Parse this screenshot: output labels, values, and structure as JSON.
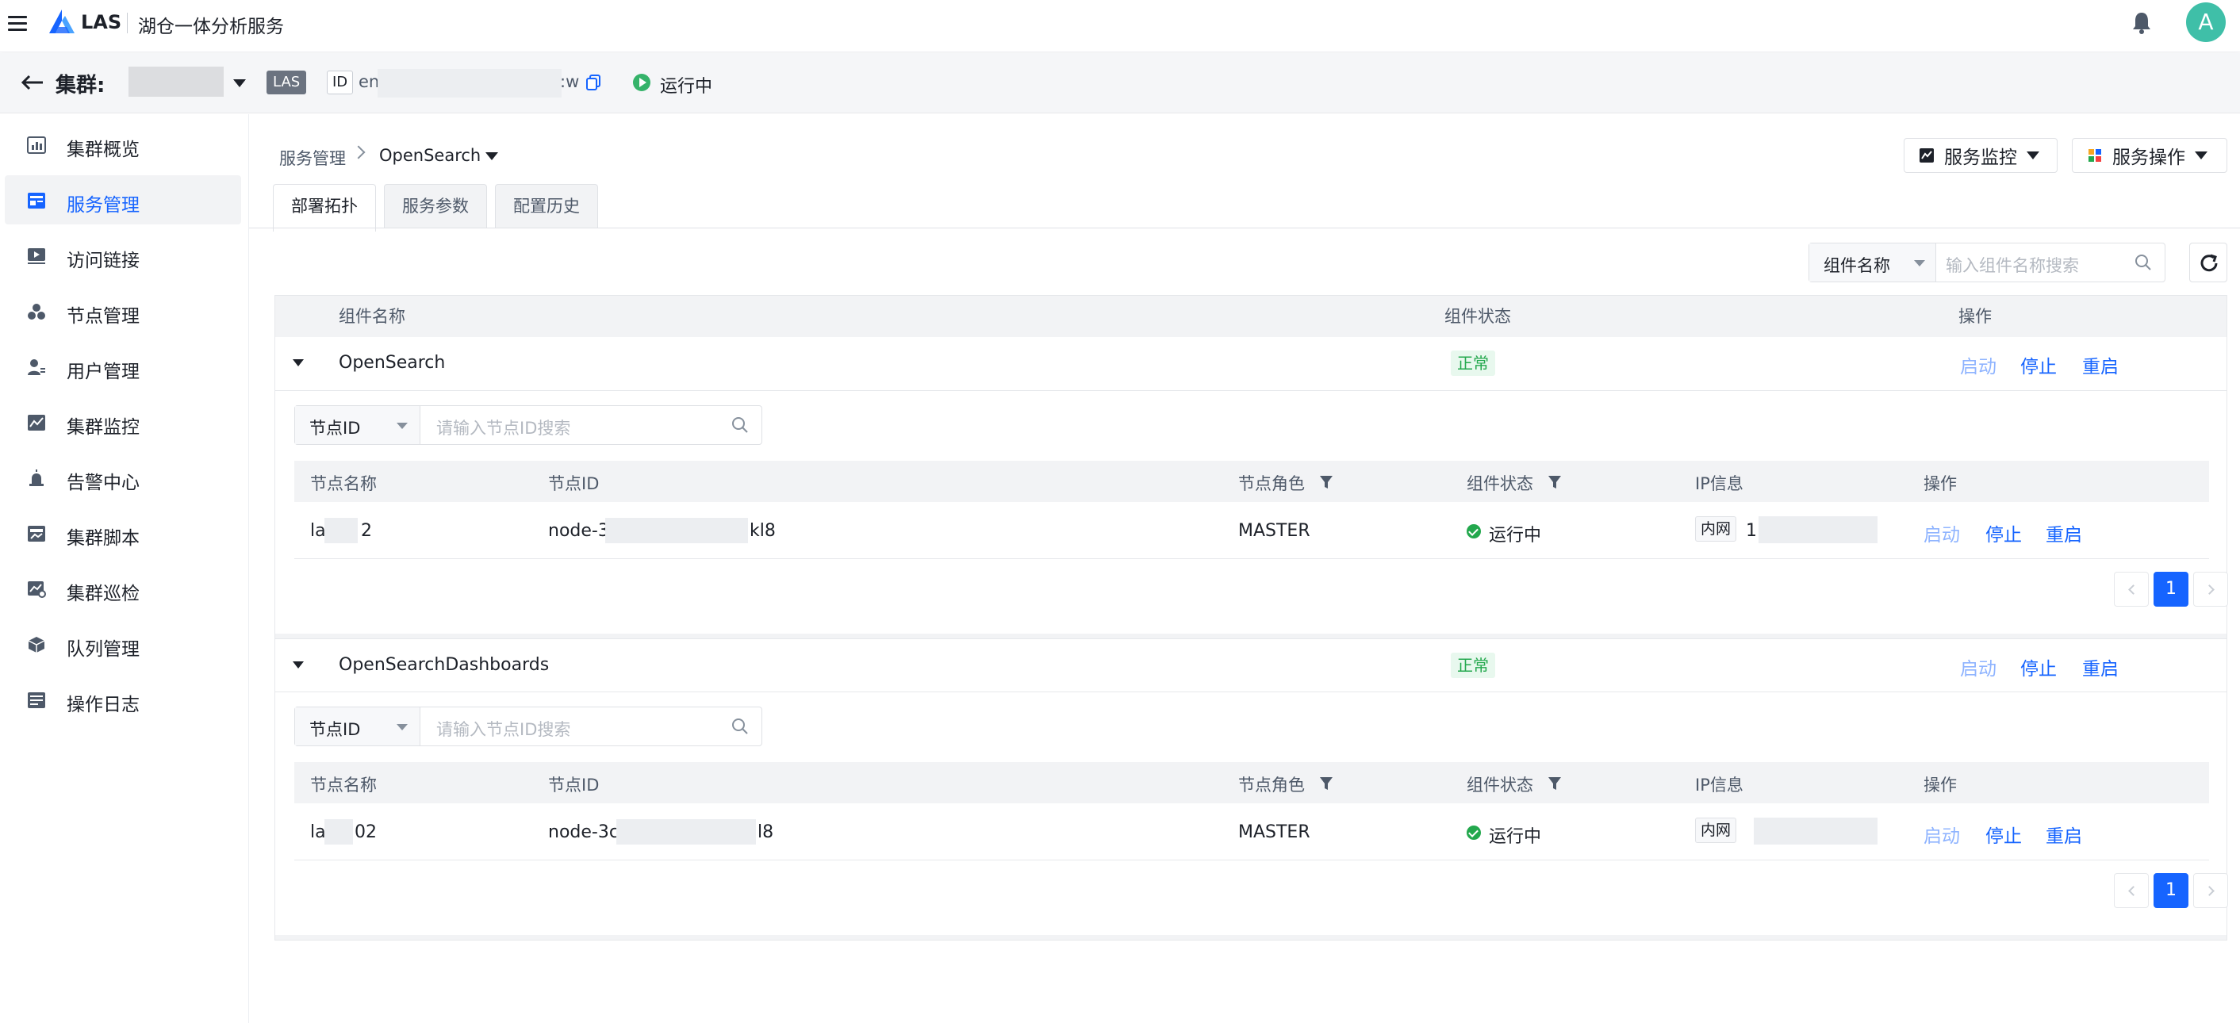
{
  "topbar": {
    "brand": "LAS",
    "subtitle": "湖仓一体分析服务",
    "avatar_initial": "A"
  },
  "cluster_bar": {
    "label": "集群:",
    "las_tag": "LAS",
    "id_tag": "ID",
    "id_prefix": "en",
    "id_suffix": ":w",
    "status": "运行中"
  },
  "sidebar": {
    "items": [
      {
        "label": "集群概览",
        "icon": "bar-chart-icon"
      },
      {
        "label": "服务管理",
        "icon": "service-icon"
      },
      {
        "label": "访问链接",
        "icon": "link-play-icon"
      },
      {
        "label": "节点管理",
        "icon": "nodes-icon"
      },
      {
        "label": "用户管理",
        "icon": "user-icon"
      },
      {
        "label": "集群监控",
        "icon": "monitor-chart-icon"
      },
      {
        "label": "告警中心",
        "icon": "alarm-icon"
      },
      {
        "label": "集群脚本",
        "icon": "script-icon"
      },
      {
        "label": "集群巡检",
        "icon": "inspect-icon"
      },
      {
        "label": "队列管理",
        "icon": "cube-icon"
      },
      {
        "label": "操作日志",
        "icon": "log-icon"
      }
    ],
    "active_index": 1
  },
  "breadcrumb": {
    "parent": "服务管理",
    "current": "OpenSearch"
  },
  "actions": {
    "monitor": "服务监控",
    "operate": "服务操作"
  },
  "tabs": [
    "部署拓扑",
    "服务参数",
    "配置历史"
  ],
  "component_filter": {
    "select": "组件名称",
    "placeholder": "输入组件名称搜索"
  },
  "component_table": {
    "headers": {
      "name": "组件名称",
      "status": "组件状态",
      "ops": "操作"
    }
  },
  "components": [
    {
      "name": "OpenSearch",
      "status": "正常",
      "ops": {
        "start": "启动",
        "stop": "停止",
        "restart": "重启"
      },
      "node_filter": {
        "select": "节点ID",
        "placeholder": "请输入节点ID搜索"
      },
      "node_headers": {
        "name": "节点名称",
        "id": "节点ID",
        "role": "节点角色",
        "status": "组件状态",
        "ip": "IP信息",
        "ops": "操作"
      },
      "nodes": [
        {
          "name_prefix": "la",
          "name_suffix": "2",
          "id_prefix": "node-3",
          "id_suffix": "kl8",
          "role": "MASTER",
          "status": "运行中",
          "net": "内网",
          "ip_prefix": "1"
        }
      ],
      "page": "1"
    },
    {
      "name": "OpenSearchDashboards",
      "status": "正常",
      "ops": {
        "start": "启动",
        "stop": "停止",
        "restart": "重启"
      },
      "node_filter": {
        "select": "节点ID",
        "placeholder": "请输入节点ID搜索"
      },
      "node_headers": {
        "name": "节点名称",
        "id": "节点ID",
        "role": "节点角色",
        "status": "组件状态",
        "ip": "IP信息",
        "ops": "操作"
      },
      "nodes": [
        {
          "name_prefix": "la",
          "name_suffix": "02",
          "id_prefix": "node-3c",
          "id_suffix": "l8",
          "role": "MASTER",
          "status": "运行中",
          "net": "内网",
          "ip_prefix": ""
        }
      ],
      "page": "1"
    }
  ],
  "colors": {
    "primary": "#1664ff",
    "success": "#23a84d",
    "avatar": "#3fbfa8"
  }
}
